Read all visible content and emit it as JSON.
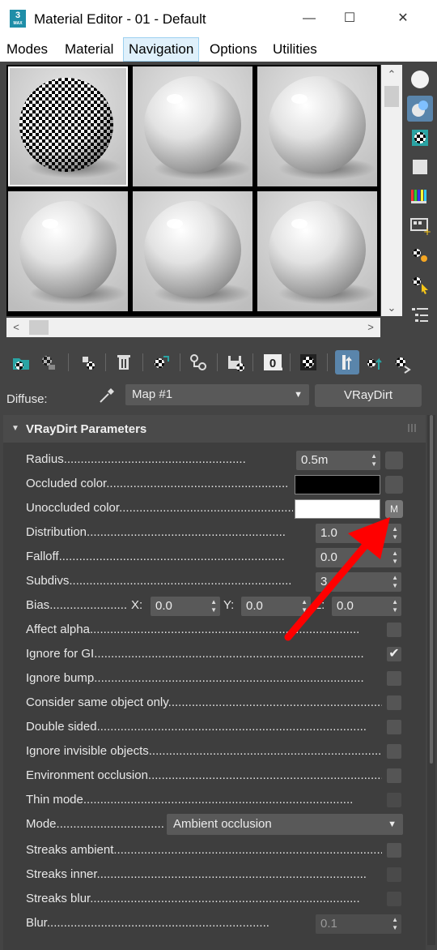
{
  "window": {
    "title": "Material Editor - 01 - Default",
    "app_icon_label": "3",
    "app_icon_sub": "MAX",
    "minimize": "—",
    "maximize": "☐",
    "close": "✕"
  },
  "menu": {
    "items": [
      "Modes",
      "Material",
      "Navigation",
      "Options",
      "Utilities"
    ],
    "active": "Navigation"
  },
  "slots": {
    "count": 6,
    "selected_index": 0,
    "first_slot": "checker",
    "other_slots": "glossy-white"
  },
  "scrollbars": {
    "up": "⌃",
    "down": "⌄",
    "left": "<",
    "right": ">"
  },
  "side_tools": [
    "sample-sphere-icon",
    "backlight-icon",
    "background-checker-icon",
    "sample-uv-tiling-icon",
    "video-color-check-icon",
    "make-preview-icon",
    "options-icon",
    "select-by-material-icon",
    "material-map-navigator-icon"
  ],
  "toolbar_icons": [
    "get-material-icon",
    "put-to-scene-icon",
    "assign-to-selection-icon",
    "reset-map-icon",
    "make-unique-icon",
    "put-to-library-icon",
    "material-id-channel-icon",
    "show-shaded-icon",
    "show-end-result-icon",
    "go-to-parent-icon",
    "go-forward-sibling-icon"
  ],
  "toolbar": {
    "material_id": "0"
  },
  "diffuse": {
    "label": "Diffuse:",
    "map_name": "Map #1",
    "type_button": "VRayDirt"
  },
  "rollout": {
    "title": "VRayDirt Parameters",
    "collapse_glyph": "▼"
  },
  "params": {
    "radius": {
      "label": "Radius",
      "value": "0.5m"
    },
    "occluded": {
      "label": "Occluded color",
      "color": "#000000"
    },
    "unoccluded": {
      "label": "Unoccluded color",
      "color": "#ffffff",
      "map_button": "M"
    },
    "distribution": {
      "label": "Distribution",
      "value": "1.0"
    },
    "falloff": {
      "label": "Falloff",
      "value": "0.0"
    },
    "subdivs": {
      "label": "Subdivs",
      "value": "3"
    },
    "bias": {
      "label": "Bias",
      "x_label": "X:",
      "x": "0.0",
      "y_label": "Y:",
      "y": "0.0",
      "z_label": "Z:",
      "z": "0.0"
    },
    "checkboxes": [
      {
        "label": "Affect alpha",
        "checked": false,
        "enabled": true
      },
      {
        "label": "Ignore for GI",
        "checked": true,
        "enabled": true
      },
      {
        "label": "Ignore bump",
        "checked": false,
        "enabled": true
      },
      {
        "label": "Consider same object only",
        "checked": false,
        "enabled": true
      },
      {
        "label": "Double sided",
        "checked": false,
        "enabled": true
      },
      {
        "label": "Ignore invisible objects",
        "checked": false,
        "enabled": true
      },
      {
        "label": "Environment occlusion",
        "checked": false,
        "enabled": true
      },
      {
        "label": "Thin mode",
        "checked": false,
        "enabled": false
      }
    ],
    "mode": {
      "label": "Mode",
      "value": "Ambient occlusion"
    },
    "streaks": [
      {
        "label": "Streaks ambient",
        "checked": false,
        "enabled": true
      },
      {
        "label": "Streaks inner",
        "checked": false,
        "enabled": false
      },
      {
        "label": "Streaks blur",
        "checked": false,
        "enabled": false
      }
    ],
    "blur": {
      "label": "Blur",
      "value": "0.1"
    }
  },
  "annotation": {
    "arrow_color": "#ff0000",
    "points_to": "unoccluded-map-button"
  },
  "colors": {
    "panel_bg": "#444444",
    "accent": "#5a85ab"
  }
}
